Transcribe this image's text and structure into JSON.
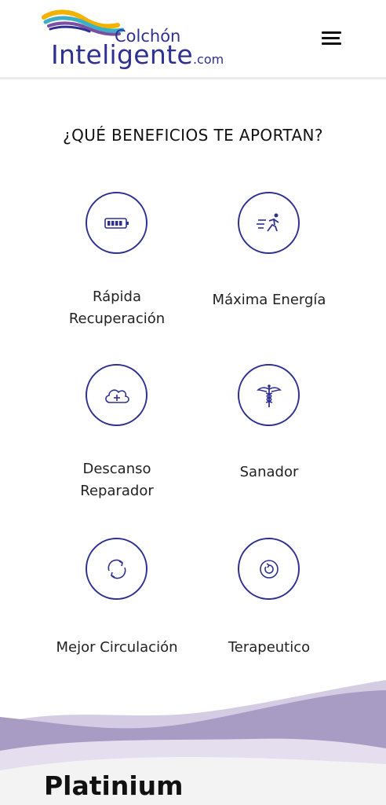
{
  "header": {
    "logo_top": "Colchón",
    "logo_main": "Inteligente",
    "logo_suffix": ".com",
    "menu_icon": "hamburger-menu-icon"
  },
  "section": {
    "title": "¿QUÉ BENEFICIOS TE APORTAN?",
    "benefits": [
      {
        "line1": "Rápida",
        "line2": "Recuperación",
        "icon": "battery-icon"
      },
      {
        "line1": "Máxima Energía",
        "line2": "",
        "icon": "running-person-icon"
      },
      {
        "line1": "Descanso",
        "line2": "Reparador",
        "icon": "cloud-plus-icon"
      },
      {
        "line1": "Sanador",
        "line2": "",
        "icon": "caduceus-icon"
      },
      {
        "line1": "Mejor Circulación",
        "line2": "",
        "icon": "circular-arrows-icon"
      },
      {
        "line1": "Terapeutico",
        "line2": "",
        "icon": "rotate-circle-icon"
      }
    ]
  },
  "next_section": {
    "title": "Platinium"
  },
  "colors": {
    "brand_blue": "#2e3192",
    "wave_purple": "#a89bc4",
    "wave_light": "#d4cce3"
  }
}
